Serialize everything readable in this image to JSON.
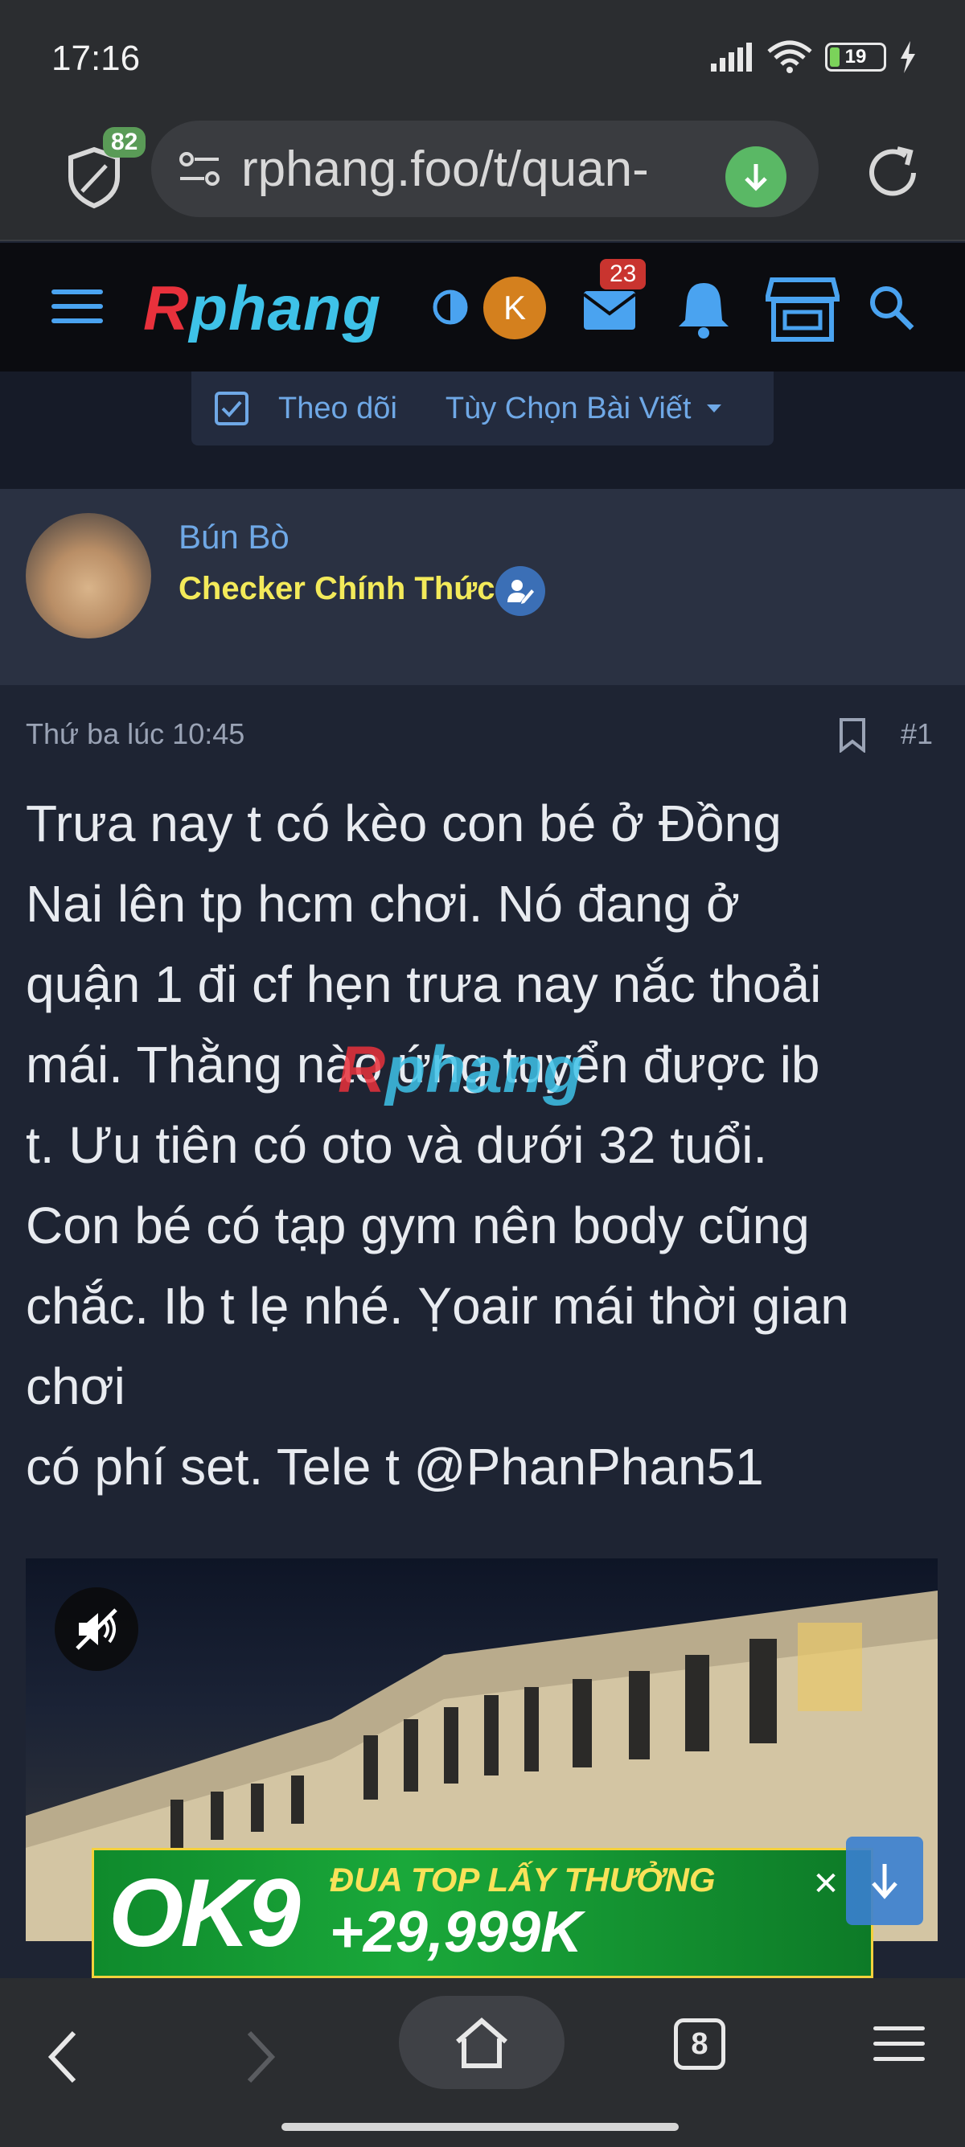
{
  "status_bar": {
    "time": "17:16",
    "battery": "19"
  },
  "browser": {
    "shield_count": "82",
    "url": "rphang.foo/t/quan-",
    "tabs_count": "8"
  },
  "site": {
    "logo_r": "R",
    "logo_rest": "phang",
    "user_initial": "K",
    "mail_count": "23"
  },
  "thread_actions": {
    "follow": "Theo dõi",
    "options": "Tùy Chọn Bài Viết"
  },
  "post": {
    "author": "Bún Bò",
    "author_title": "Checker Chính Thức",
    "timestamp": "Thứ ba lúc 10:45",
    "number": "#1",
    "lines": [
      "Trưa nay t có kèo con bé ở Đồng",
      "Nai lên tp hcm chơi. Nó đang ở",
      "quận 1 đi cf hẹn trưa nay nắc thoải",
      "mái. Thằng nào ứng tuyển được ib",
      "t. Ưu tiên có oto và dưới 32 tuổi.",
      "Con bé có tạp gym nên body cũng",
      "chắc. Ib t lẹ nhé. Ỵoair mái thời gian",
      "chơi",
      "có phí set. Tele t @PhanPhan51"
    ],
    "watermark_r": "R",
    "watermark_rest": "phang"
  },
  "ad": {
    "logo": "OK9",
    "line1": "ĐUA TOP LẤY THƯỞNG",
    "line2": "+29,999K"
  },
  "colors": {
    "accent_blue": "#6fa8e6",
    "title_yellow": "#f3ea5a",
    "badge_red": "#c9342f",
    "background": "#1e2433"
  }
}
